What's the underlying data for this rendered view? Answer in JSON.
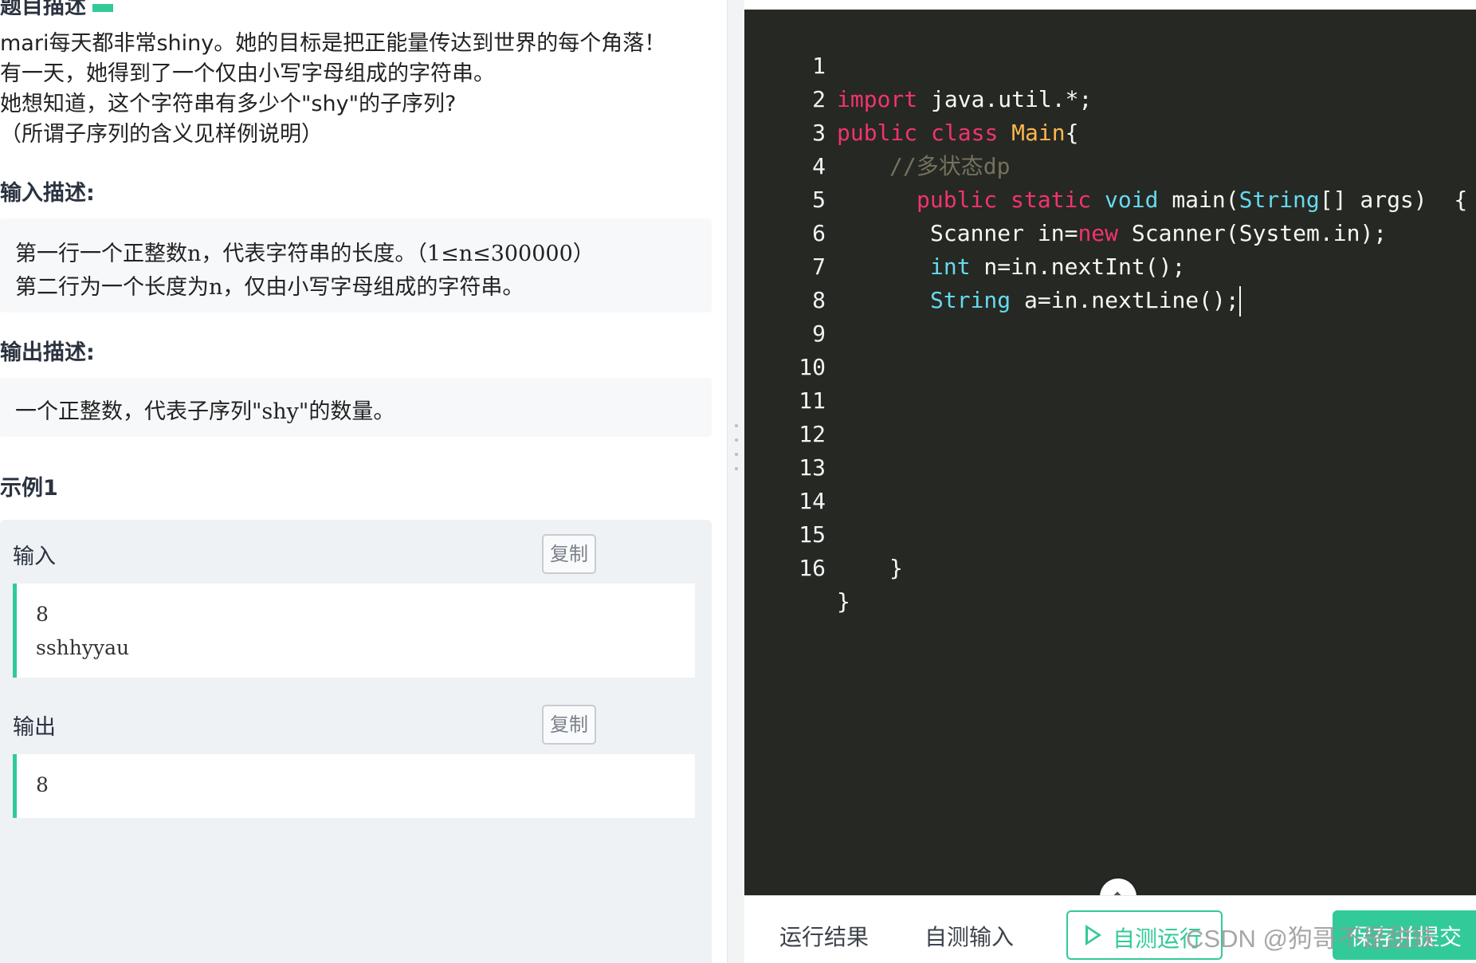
{
  "problem": {
    "title": "题目描述",
    "description": [
      "mari每天都非常shiny。她的目标是把正能量传达到世界的每个角落！",
      "有一天，她得到了一个仅由小写字母组成的字符串。",
      "她想知道，这个字符串有多少个\"shy\"的子序列?",
      "（所谓子序列的含义见样例说明）"
    ],
    "input_title": "输入描述:",
    "input_lines": [
      "第一行一个正整数n，代表字符串的长度。（1≤n≤300000）",
      "第二行为一个长度为n，仅由小写字母组成的字符串。"
    ],
    "output_title": "输出描述:",
    "output_lines": [
      "一个正整数，代表子序列\"shy\"的数量。"
    ],
    "example_title": "示例1",
    "example": {
      "input_label": "输入",
      "copy_label": "复制",
      "input_lines": [
        "8",
        "sshhyyau"
      ],
      "output_label": "输出",
      "output_lines": [
        "8"
      ]
    }
  },
  "editor": {
    "line_numbers": [
      "1",
      "2",
      "3",
      "4",
      "5",
      "6",
      "7",
      "8",
      "9",
      "10",
      "11",
      "12",
      "13",
      "14",
      "15",
      "16"
    ],
    "code": {
      "l1_kw": "import",
      "l1_rest": " java.util.*;",
      "l2_kw1": "public",
      "l2_kw2": "class",
      "l2_cls": "Main",
      "l2_rest": "{",
      "l3_comment": "//多状态dp",
      "l4_kw1": "public",
      "l4_kw2": "static",
      "l4_ty1": "void",
      "l4_rest1": " main(",
      "l4_ty2": "String",
      "l4_rest2": "[] args)  {",
      "l5_a": "Scanner in=",
      "l5_kw": "new",
      "l5_b": " Scanner(System.in);",
      "l6_ty": "int",
      "l6_rest": " n=in.nextInt();",
      "l7_ty": "String",
      "l7_rest": " a=in.nextLine();",
      "l15": "}",
      "l16": "}"
    }
  },
  "bottom_bar": {
    "tab_result": "运行结果",
    "tab_custom_input": "自测输入",
    "run_label": "自测运行",
    "submit_label": "保存并提交"
  },
  "watermark": "CSDN @狗哥不是甜妹",
  "colors": {
    "accent": "#32ca99",
    "editor_bg": "#262823",
    "keyword": "#f1346c",
    "type": "#66d9ef",
    "class_name": "#ffb74d",
    "comment": "#75715e"
  }
}
